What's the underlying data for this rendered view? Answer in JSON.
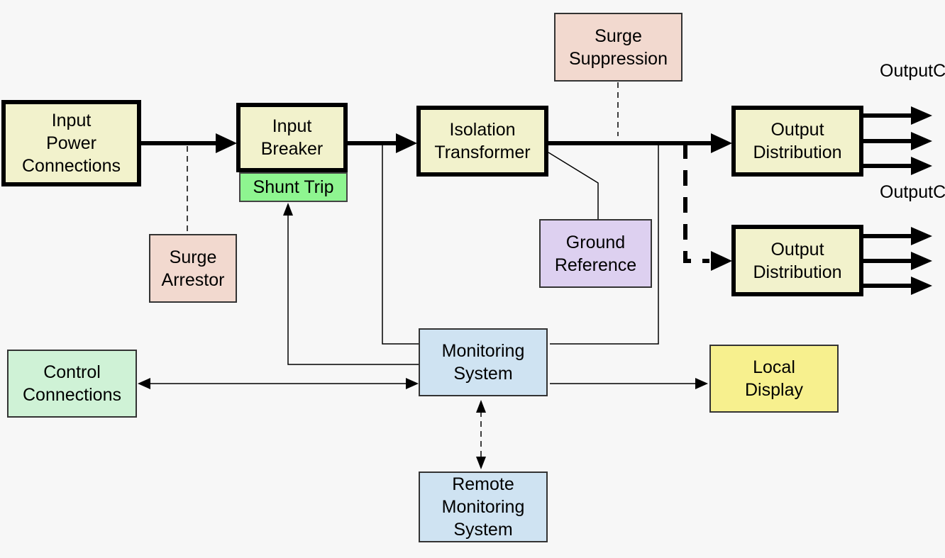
{
  "colors": {
    "background": "#f7f7f7",
    "main_block": "#f2f2cc",
    "surge": "#f2d9cf",
    "shunt_trip": "#8ef590",
    "ground_reference": "#ddd0f0",
    "control": "#cff2d6",
    "monitoring": "#cfe3f2",
    "local_display": "#f7f08e"
  },
  "blocks": {
    "input_power": {
      "lines": [
        "Input",
        "Power",
        "Connections"
      ]
    },
    "input_breaker": {
      "lines": [
        "Input",
        "Breaker"
      ]
    },
    "shunt_trip": {
      "lines": [
        "Shunt Trip"
      ]
    },
    "isolation_transformer": {
      "lines": [
        "Isolation",
        "Transformer"
      ]
    },
    "surge_suppression": {
      "lines": [
        "Surge",
        "Suppression"
      ]
    },
    "surge_arrestor": {
      "lines": [
        "Surge",
        "Arrestor"
      ]
    },
    "ground_reference": {
      "lines": [
        "Ground",
        "Reference"
      ]
    },
    "output_distribution_1": {
      "lines": [
        "Output",
        "Distribution"
      ]
    },
    "output_distribution_2": {
      "lines": [
        "Output",
        "Distribution"
      ]
    },
    "monitoring_system": {
      "lines": [
        "Monitoring",
        "System"
      ]
    },
    "control_connections": {
      "lines": [
        "Control",
        "Connections"
      ]
    },
    "local_display": {
      "lines": [
        "Local",
        "Display"
      ]
    },
    "remote_monitoring": {
      "lines": [
        "Remote",
        "Monitoring",
        "System"
      ]
    }
  },
  "labels": {
    "output_cables_1": [
      "Output",
      "Cables"
    ],
    "output_cables_2": [
      "Output",
      "Cables"
    ]
  }
}
